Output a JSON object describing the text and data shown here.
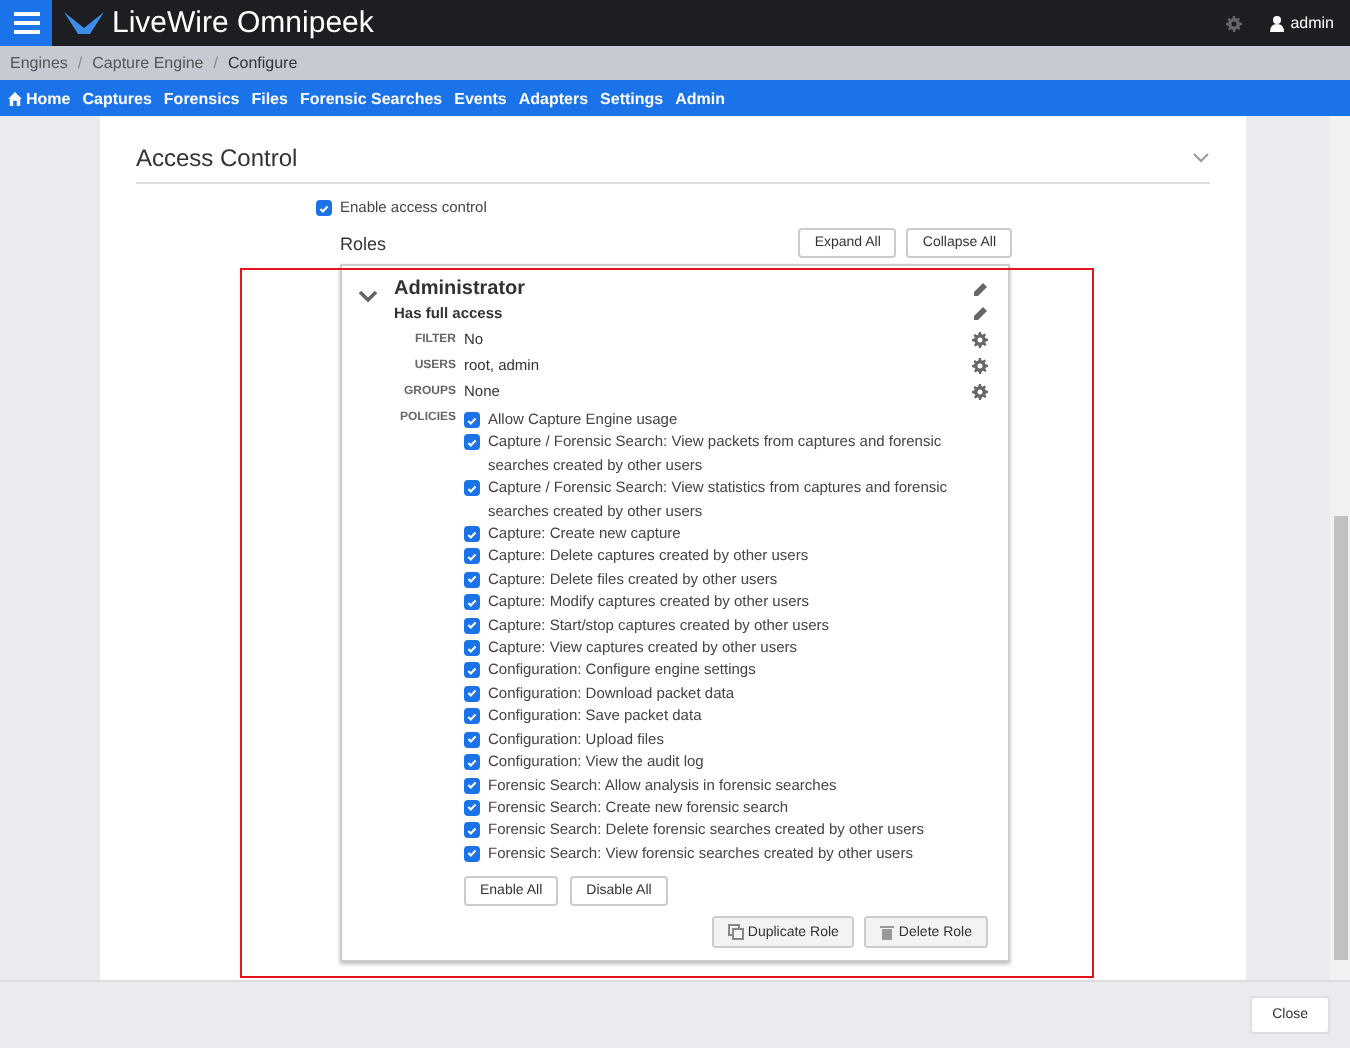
{
  "app": {
    "title": "LiveWire Omnipeek",
    "user": "admin"
  },
  "breadcrumb": [
    {
      "label": "Engines"
    },
    {
      "separator": "/",
      "label": "Capture Engine"
    },
    {
      "separator": "/",
      "label": "Configure"
    }
  ],
  "nav": [
    {
      "label": "Home",
      "kind": "home"
    },
    {
      "label": "Captures"
    },
    {
      "label": "Forensics"
    },
    {
      "label": "Files"
    },
    {
      "label": "Forensic Searches"
    },
    {
      "label": "Events"
    },
    {
      "label": "Adapters"
    },
    {
      "label": "Settings"
    },
    {
      "label": "Admin"
    }
  ],
  "section": {
    "title": "Access Control",
    "expanded": true
  },
  "enable_access_control": {
    "label": "Enable access control",
    "checked": true
  },
  "roles": {
    "title": "Roles",
    "buttons": [
      "Expand All",
      "Collapse All"
    ],
    "items": [
      {
        "name": "Administrator",
        "description": "Has full access",
        "expanded": true,
        "fields": [
          {
            "label": "FILTER",
            "value": "No"
          },
          {
            "label": "USERS",
            "value": "root, admin"
          },
          {
            "label": "GROUPS",
            "value": "None"
          }
        ],
        "policies_label": "POLICIES",
        "policies": [
          {
            "label": "Allow Capture Engine usage",
            "checked": true
          },
          {
            "label": "Capture / Forensic Search: View packets from captures and forensic searches created by other users",
            "checked": true
          },
          {
            "label": "Capture / Forensic Search: View statistics from captures and forensic searches created by other users",
            "checked": true
          },
          {
            "label": "Capture: Create new capture",
            "checked": true
          },
          {
            "label": "Capture: Delete captures created by other users",
            "checked": true
          },
          {
            "label": "Capture: Delete files created by other users",
            "checked": true
          },
          {
            "label": "Capture: Modify captures created by other users",
            "checked": true
          },
          {
            "label": "Capture: Start/stop captures created by other users",
            "checked": true
          },
          {
            "label": "Capture: View captures created by other users",
            "checked": true
          },
          {
            "label": "Configuration: Configure engine settings",
            "checked": true
          },
          {
            "label": "Configuration: Download packet data",
            "checked": true
          },
          {
            "label": "Configuration: Save packet data",
            "checked": true
          },
          {
            "label": "Configuration: Upload files",
            "checked": true
          },
          {
            "label": "Configuration: View the audit log",
            "checked": true
          },
          {
            "label": "Forensic Search: Allow analysis in forensic searches",
            "checked": true
          },
          {
            "label": "Forensic Search: Create new forensic search",
            "checked": true
          },
          {
            "label": "Forensic Search: Delete forensic searches created by other users",
            "checked": true
          },
          {
            "label": "Forensic Search: View forensic searches created by other users",
            "checked": true
          }
        ],
        "policy_buttons": [
          "Enable All",
          "Disable All"
        ],
        "role_buttons": [
          {
            "label": "Duplicate Role",
            "kind": "copy"
          },
          {
            "label": "Delete Role",
            "kind": "trash"
          }
        ]
      }
    ]
  },
  "footer": {
    "button": "Close"
  }
}
